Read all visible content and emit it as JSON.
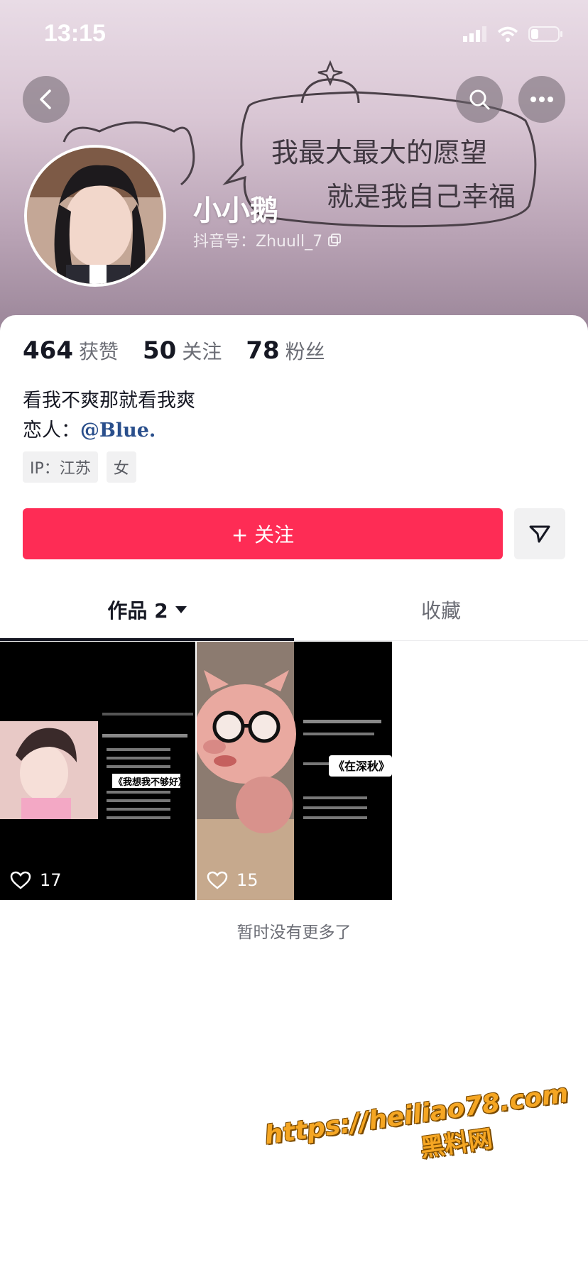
{
  "status_bar": {
    "time": "13:15"
  },
  "header": {
    "banner_text_line1": "我最大最大的愿望",
    "banner_text_line2": "就是我自己幸福",
    "nickname": "小小鹅",
    "douyin_id": "抖音号：Zhuull_7"
  },
  "stats": [
    {
      "num": "464",
      "label": "获赞"
    },
    {
      "num": "50",
      "label": "关注"
    },
    {
      "num": "78",
      "label": "粉丝"
    }
  ],
  "bio": {
    "line1": "看我不爽那就看我爽",
    "lover_prefix": "恋人：",
    "lover_handle": "@Blue."
  },
  "tags": [
    "IP：江苏",
    "女"
  ],
  "actions": {
    "follow_label": "+ 关注"
  },
  "tabs": [
    {
      "label": "作品 2",
      "active": true
    },
    {
      "label": "收藏",
      "active": false
    }
  ],
  "videos": [
    {
      "likes": "17",
      "overlay_title": "《我想我不够好》"
    },
    {
      "likes": "15",
      "overlay_title": "《在深秋》"
    }
  ],
  "footer_text": "暂时没有更多了",
  "watermark": {
    "url": "https://heiliao78.com",
    "name": "黑料网"
  },
  "colors": {
    "accent": "#fe2c55",
    "text": "#161823",
    "muted": "#6b6d75"
  }
}
